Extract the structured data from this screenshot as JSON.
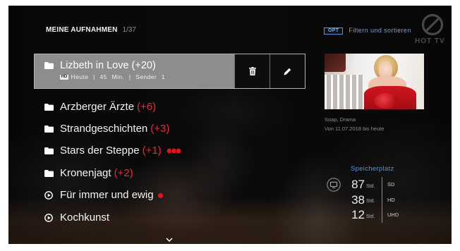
{
  "header": {
    "title": "MEINE AUFNAHMEN",
    "counter": "1/37",
    "opt_key": "OPT",
    "filter_label": "Filtern und sortieren",
    "logo_text": "HOT TV",
    "logo_icon": "hot-logo-icon"
  },
  "selected": {
    "icon": "folder-icon",
    "name": "Lizbeth in Love",
    "count": "(+20)",
    "quality": "HD",
    "meta": "Heute | 45 Min. | Sender 1",
    "actions": [
      {
        "icon": "trash-icon"
      },
      {
        "icon": "pencil-icon"
      }
    ]
  },
  "list": {
    "items": [
      {
        "icon": "folder-icon",
        "name": "Arzberger Ärzte",
        "count": "(+6)"
      },
      {
        "icon": "folder-icon",
        "name": "Strandgeschichten",
        "count": "(+3)"
      },
      {
        "icon": "folder-icon",
        "name": "Stars der Steppe",
        "count": "(+1)",
        "status_icon": "series-recording-icon"
      },
      {
        "icon": "folder-icon",
        "name": "Kronenjagt",
        "count": "(+2)"
      },
      {
        "icon": "play-circle-icon",
        "name": "Für immer und ewig",
        "status_icon": "recording-dot-icon"
      },
      {
        "icon": "play-circle-icon",
        "name": "Kochkunst"
      }
    ],
    "more_icon": "chevron-down-icon"
  },
  "details": {
    "genre": "Soap, Drama",
    "date_range": "Von 11.07.2018 bis heute"
  },
  "storage": {
    "title": "Speicherplatz",
    "icon": "tv-icon",
    "rows": [
      {
        "hours": "87",
        "unit": "Std.",
        "quality": "SD"
      },
      {
        "hours": "38",
        "unit": "Std.",
        "quality": "HD"
      },
      {
        "hours": "12",
        "unit": "Std.",
        "quality": "UHD"
      }
    ]
  },
  "colors": {
    "accent_blue": "#4f95dd",
    "count_red": "#e8283c",
    "recording_red": "#e1141f",
    "selected_row": "#8d8d8d"
  }
}
